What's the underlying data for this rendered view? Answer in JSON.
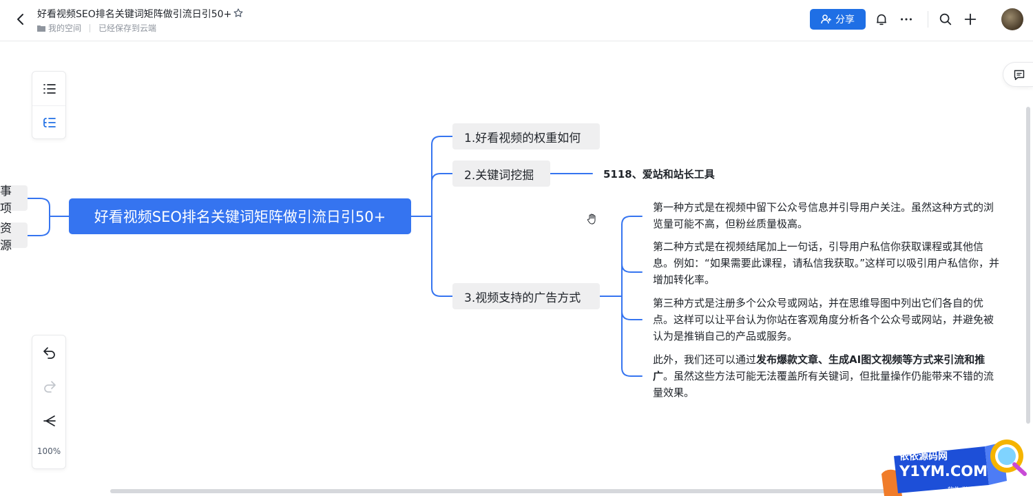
{
  "header": {
    "title": "好看视频SEO排名关键词矩阵做引流日引50+",
    "breadcrumb_space": "我的空间",
    "save_status": "已经保存到云端",
    "share_label": "分享",
    "accent_color": "#1f6fe5"
  },
  "toolbar": {
    "zoom": "100%",
    "top_icons": [
      "outline-icon",
      "mindmap-layout-icon"
    ],
    "bottom_icons": [
      "undo-icon",
      "redo-icon",
      "layout-tree-icon"
    ]
  },
  "mindmap": {
    "root": "好看视频SEO排名关键词矩阵做引流日引50+",
    "root_color": "#3574f0",
    "left_nodes": [
      "事项",
      "资源"
    ],
    "branches": [
      {
        "label": "1.好看视频的权重如何"
      },
      {
        "label": "2.关键词挖掘",
        "child": "5118、爱站和站长工具"
      },
      {
        "label": "3.视频支持的广告方式"
      }
    ],
    "ad_methods": {
      "p1": "第一种方式是在视频中留下公众号信息并引导用户关注。虽然这种方式的浏览量可能不高，但粉丝质量极高。",
      "p2": "第二种方式是在视频结尾加上一句话，引导用户私信你获取课程或其他信息。例如：“如果需要此课程，请私信我获取。”这样可以吸引用户私信你，并增加转化率。",
      "p3": "第三种方式是注册多个公众号或网站，并在思维导图中列出它们各自的优点。这样可以让平台认为你站在客观角度分析各个公众号或网站，并避免被认为是推销自己的产品或服务。",
      "p4_prefix": "此外，我们还可以通过",
      "p4_bold": "发布爆款文章、生成AI图文视频等方式来引流和推广",
      "p4_suffix": "。虽然这些方法可能无法覆盖所有关键词，但批量操作仍能带来不错的流量效果。"
    }
  },
  "watermark": {
    "line1": "依依源码网",
    "line2": "Y1YM.COM",
    "line3": "软件/游戏/小程序/棋牌"
  }
}
